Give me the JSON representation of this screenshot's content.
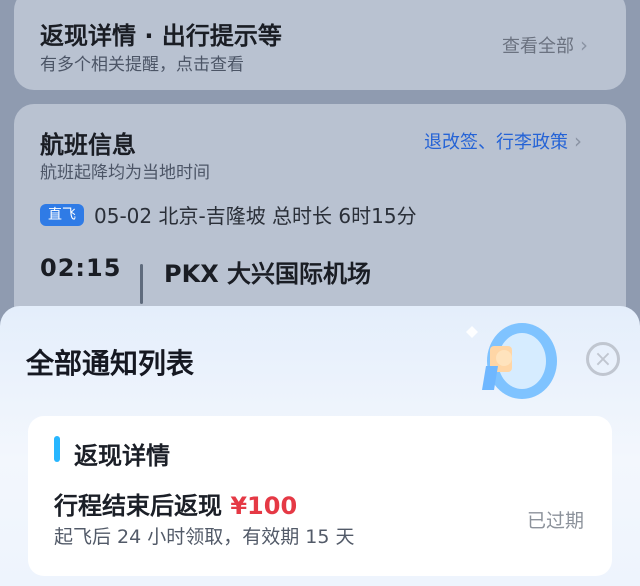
{
  "background": {
    "card1": {
      "title": "返现详情 · 出行提示等",
      "subtitle": "有多个相关提醒，点击查看",
      "link": "查看全部"
    },
    "card2": {
      "title": "航班信息",
      "subtitle": "航班起降均为当地时间",
      "link": "退改签、行李政策",
      "flight": {
        "tag": "直飞",
        "summary": "05-02 北京-吉隆坡 总时长 6时15分",
        "time": "02:15",
        "airport": "PKX 大兴国际机场"
      }
    }
  },
  "sheet": {
    "title": "全部通知列表",
    "close_icon": "close-icon",
    "notice": {
      "title": "返现详情",
      "line1_prefix": "行程结束后返现 ",
      "amount": "¥100",
      "line2": "起飞后 24 小时领取，有效期 15 天",
      "status": "已过期"
    }
  },
  "colors": {
    "accent_blue": "#2563d6",
    "amount_red": "#e53945",
    "bar_blue": "#27b6ff"
  }
}
